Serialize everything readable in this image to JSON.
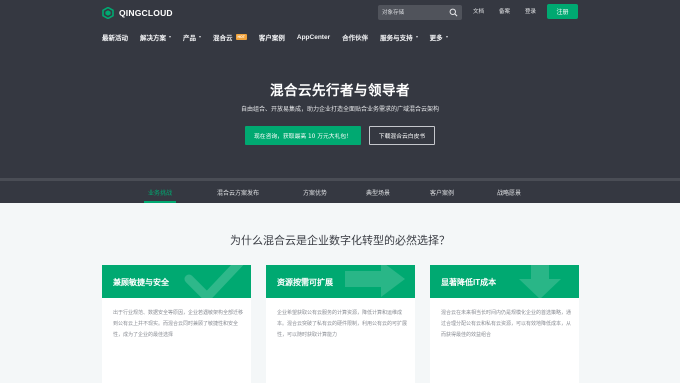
{
  "header": {
    "logo_text": "QINGCLOUD",
    "search_placeholder": "对象存储",
    "links": {
      "docs": "文档",
      "filing": "备案",
      "login": "登录"
    },
    "register_label": "注册",
    "nav": [
      {
        "label": "最新活动",
        "dropdown": false
      },
      {
        "label": "解决方案",
        "dropdown": true
      },
      {
        "label": "产品",
        "dropdown": true
      },
      {
        "label": "混合云",
        "dropdown": false,
        "badge": "HOT"
      },
      {
        "label": "客户案例",
        "dropdown": false
      },
      {
        "label": "AppCenter",
        "dropdown": false
      },
      {
        "label": "合作伙伴",
        "dropdown": false
      },
      {
        "label": "服务与支持",
        "dropdown": true
      },
      {
        "label": "更多",
        "dropdown": true
      }
    ]
  },
  "hero": {
    "title": "混合云先行者与领导者",
    "subtitle": "自由组合、开放易集成，助力企业打造全面贴合业务需求的广域混合云架构",
    "primary_button": "现在咨询，获取最高 10 万元大礼包！",
    "secondary_button": "下载混合云白皮书"
  },
  "subnav": {
    "tabs": [
      "业务挑战",
      "混合云方案发布",
      "方案优势",
      "典型场景",
      "客户案例",
      "战略愿景"
    ],
    "active_index": 0
  },
  "section": {
    "title": "为什么混合云是企业数字化转型的必然选择？",
    "cards": [
      {
        "title": "兼顾敏捷与安全",
        "desc": "出于行业规范、数据安全等原因，企业若遇敏架构全部迁移到公有云上并不现实。而混合云同时兼顾了敏捷性和安全性，成为了企业的最佳选择"
      },
      {
        "title": "资源按需可扩展",
        "desc": "企业希望获取公有云服务的计算资源，降低计算和运维成本。混合云突破了私有云的硬件限制，利用公有云的可扩展性，可以随时获取计算能力"
      },
      {
        "title": "显著降低IT成本",
        "desc": "混合云在未来相当长时间内仍是规模化企业的首选策略，通过合理分配公有云和私有云资源，可以有效地降低成本，从而获得最佳的效益组合"
      }
    ]
  },
  "colors": {
    "accent": "#00a971",
    "header_bg": "#353841",
    "page_bg": "#f4f7f8",
    "hot_badge": "#f0a23b"
  },
  "icons": [
    "qingcloud-logo-icon",
    "search-icon",
    "caret-down-icon",
    "check-icon",
    "arrow-right-icon",
    "down-arrow-icon"
  ]
}
